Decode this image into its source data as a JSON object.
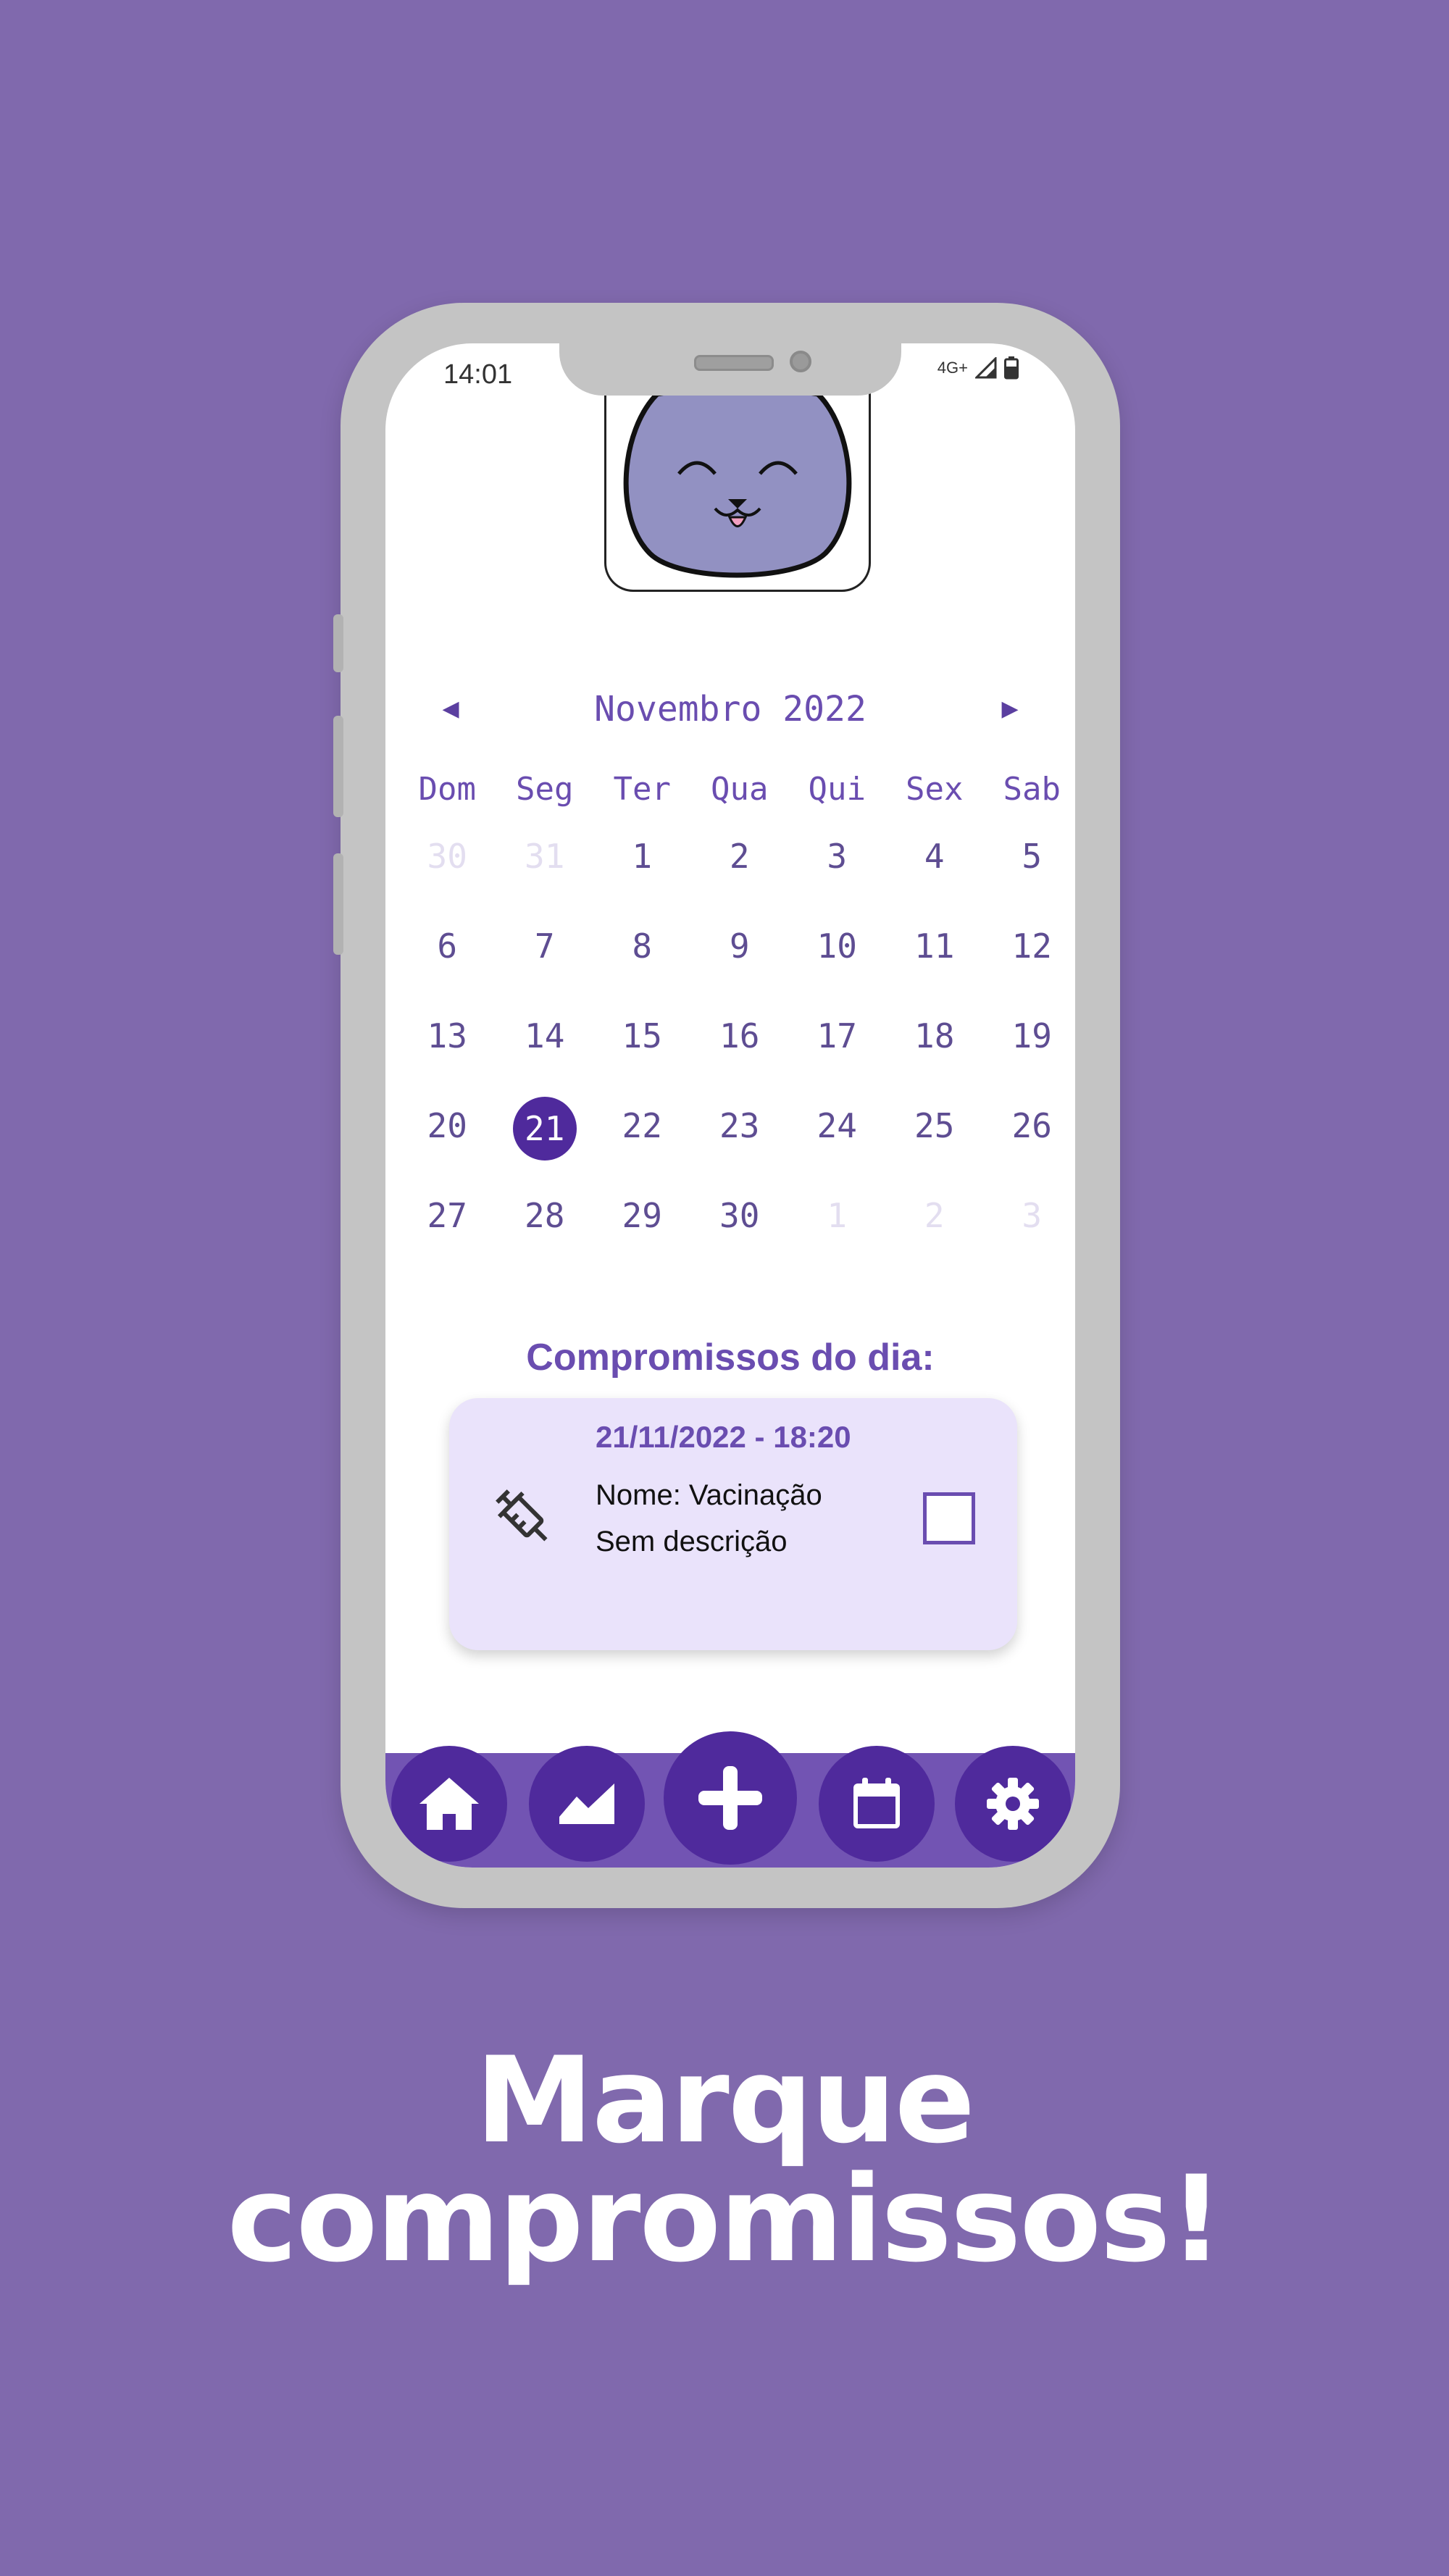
{
  "status_bar": {
    "time": "14:01",
    "network": "4G+"
  },
  "calendar": {
    "month_label": "Novembro 2022",
    "weekdays": [
      "Dom",
      "Seg",
      "Ter",
      "Qua",
      "Qui",
      "Sex",
      "Sab"
    ],
    "weeks": [
      [
        {
          "d": "30",
          "muted": true
        },
        {
          "d": "31",
          "muted": true
        },
        {
          "d": "1"
        },
        {
          "d": "2"
        },
        {
          "d": "3"
        },
        {
          "d": "4"
        },
        {
          "d": "5"
        }
      ],
      [
        {
          "d": "6"
        },
        {
          "d": "7"
        },
        {
          "d": "8"
        },
        {
          "d": "9"
        },
        {
          "d": "10"
        },
        {
          "d": "11"
        },
        {
          "d": "12"
        }
      ],
      [
        {
          "d": "13"
        },
        {
          "d": "14"
        },
        {
          "d": "15"
        },
        {
          "d": "16"
        },
        {
          "d": "17"
        },
        {
          "d": "18"
        },
        {
          "d": "19"
        }
      ],
      [
        {
          "d": "20"
        },
        {
          "d": "21",
          "selected": true
        },
        {
          "d": "22"
        },
        {
          "d": "23"
        },
        {
          "d": "24"
        },
        {
          "d": "25"
        },
        {
          "d": "26"
        }
      ],
      [
        {
          "d": "27"
        },
        {
          "d": "28"
        },
        {
          "d": "29"
        },
        {
          "d": "30"
        },
        {
          "d": "1",
          "muted": true
        },
        {
          "d": "2",
          "muted": true
        },
        {
          "d": "3",
          "muted": true
        }
      ]
    ]
  },
  "appointments": {
    "title": "Compromissos do dia:",
    "items": [
      {
        "datetime": "21/11/2022 - 18:20",
        "name": "Nome: Vacinação",
        "description": "Sem descrição",
        "icon": "syringe-icon",
        "checked": false
      }
    ]
  },
  "nav": {
    "items": [
      "home-icon",
      "chart-icon",
      "plus-icon",
      "calendar-icon",
      "gear-icon"
    ]
  },
  "promo": {
    "line1": "Marque",
    "line2": "compromissos!"
  },
  "colors": {
    "background": "#8069ad",
    "accent": "#4f2a9c",
    "nav_bar": "#7254b3",
    "card": "#eae3fb"
  }
}
